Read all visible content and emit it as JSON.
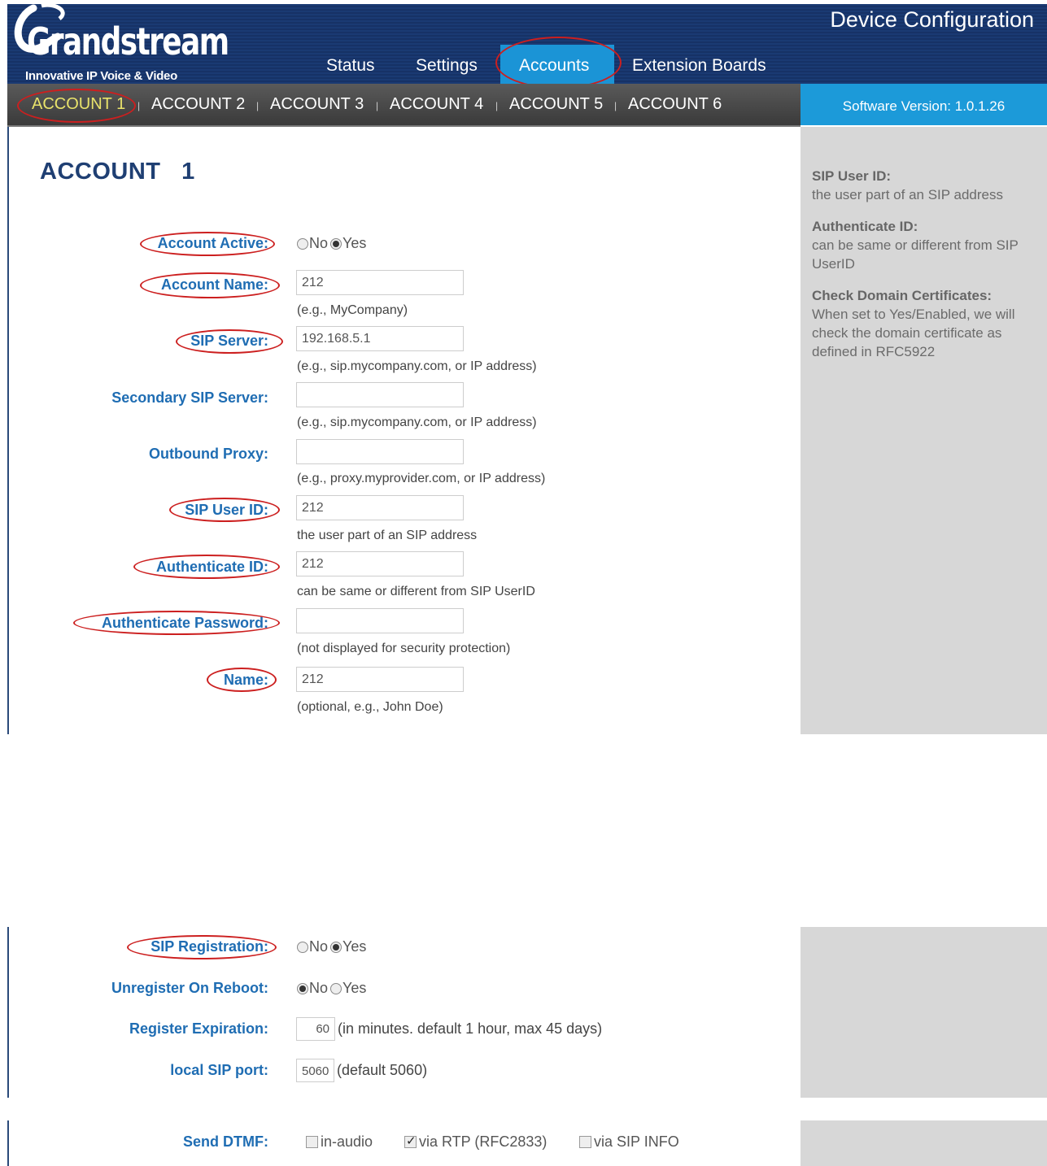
{
  "header": {
    "logo_text": "Grandstream",
    "logo_tagline": "Innovative IP Voice & Video",
    "title": "Device Configuration",
    "tabs": [
      "Status",
      "Settings",
      "Accounts",
      "Extension Boards"
    ],
    "active_tab": "Accounts",
    "active_color": "#1b94d6"
  },
  "subnav": {
    "accounts": [
      "ACCOUNT 1",
      "ACCOUNT 2",
      "ACCOUNT 3",
      "ACCOUNT 4",
      "ACCOUNT 5",
      "ACCOUNT 6"
    ],
    "active": "ACCOUNT 1",
    "active_color": "#e9e36b"
  },
  "software_version": "Software Version: 1.0.1.26",
  "page_heading": "ACCOUNT   1",
  "help": [
    {
      "title": "SIP User ID:",
      "text": "the user part of an SIP address"
    },
    {
      "title": "Authenticate ID:",
      "text": "can be same or different from SIP UserID"
    },
    {
      "title": "Check Domain Certificates:",
      "text": "When set to Yes/Enabled, we will check the domain certificate as defined in RFC5922"
    }
  ],
  "form": {
    "account_active": {
      "label": "Account Active:",
      "no": "No",
      "yes": "Yes",
      "value": "Yes"
    },
    "account_name": {
      "label": "Account Name:",
      "value": "212",
      "hint": "(e.g., MyCompany)"
    },
    "sip_server": {
      "label": "SIP Server:",
      "value": "192.168.5.1",
      "hint": "(e.g., sip.mycompany.com, or IP address)"
    },
    "secondary_sip_server": {
      "label": "Secondary SIP Server:",
      "value": "",
      "hint": "(e.g., sip.mycompany.com, or IP address)"
    },
    "outbound_proxy": {
      "label": "Outbound Proxy:",
      "value": "",
      "hint": "(e.g., proxy.myprovider.com, or IP address)"
    },
    "sip_user_id": {
      "label": "SIP User ID:",
      "value": "212",
      "hint": "the user part of an SIP address"
    },
    "authenticate_id": {
      "label": "Authenticate ID:",
      "value": "212",
      "hint": "can be same or different from SIP UserID"
    },
    "authenticate_password": {
      "label": "Authenticate Password:",
      "value": "",
      "hint": "(not displayed for security protection)"
    },
    "name": {
      "label": "Name:",
      "value": "212",
      "hint": "(optional, e.g., John Doe)"
    }
  },
  "registration": {
    "sip_registration": {
      "label": "SIP Registration:",
      "no": "No",
      "yes": "Yes",
      "value": "Yes"
    },
    "unregister_on_reboot": {
      "label": "Unregister On Reboot:",
      "no": "No",
      "yes": "Yes",
      "value": "No"
    },
    "register_expiration": {
      "label": "Register Expiration:",
      "value": "60",
      "note": "(in minutes. default 1 hour, max 45 days)"
    },
    "local_sip_port": {
      "label": "local SIP port:",
      "value": "5060",
      "note": "(default 5060)"
    }
  },
  "dtmf": {
    "label": "Send DTMF:",
    "options": [
      {
        "label": "in-audio",
        "checked": false
      },
      {
        "label": "via RTP (RFC2833)",
        "checked": true
      },
      {
        "label": "via SIP INFO",
        "checked": false
      }
    ]
  }
}
